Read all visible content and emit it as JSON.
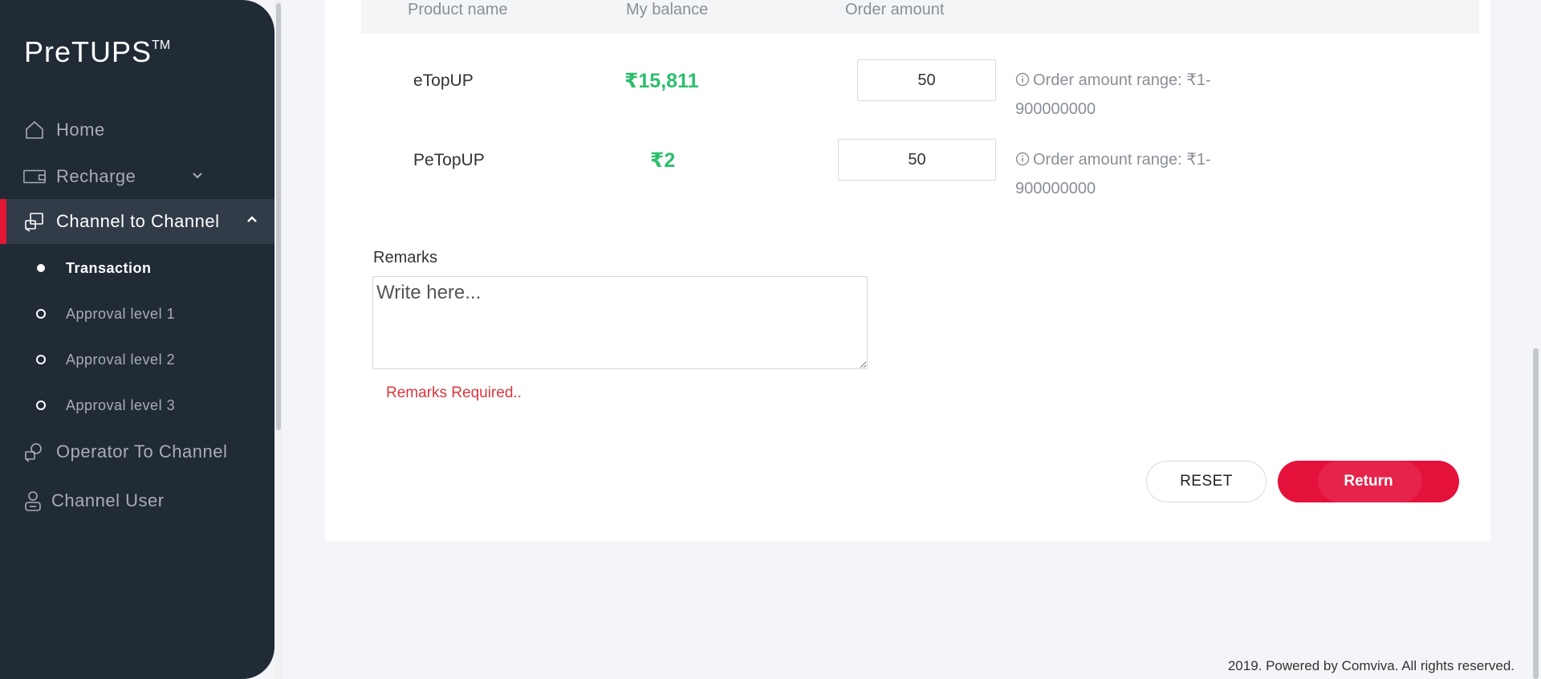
{
  "app": {
    "logo_text": "PreTUPS",
    "logo_tm": "TM"
  },
  "sidebar": {
    "items": [
      {
        "label": "Home",
        "icon": "home-icon"
      },
      {
        "label": "Recharge",
        "icon": "wallet-icon",
        "expand_icon": "chevron-down-icon"
      },
      {
        "label": "Channel to Channel",
        "icon": "channel-transfer-icon",
        "expand_icon": "chevron-up-icon",
        "active": true
      },
      {
        "label": "Operator To Channel",
        "icon": "operator-channel-icon"
      },
      {
        "label": "Channel User",
        "icon": "user-icon"
      }
    ],
    "subitems": [
      {
        "label": "Transaction",
        "active": true
      },
      {
        "label": "Approval level 1"
      },
      {
        "label": "Approval level 2"
      },
      {
        "label": "Approval level 3"
      }
    ]
  },
  "table": {
    "headers": [
      "Product name",
      "My balance",
      "Order amount"
    ],
    "rows": [
      {
        "product": "eTopUP",
        "balance": "₹15,811",
        "amount": "50",
        "range": "Order amount range: ₹1-900000000"
      },
      {
        "product": "PeTopUP",
        "balance": "₹2",
        "amount": "50",
        "range": "Order amount range: ₹1-900000000"
      }
    ]
  },
  "remarks": {
    "label": "Remarks",
    "placeholder": "Write here...",
    "value": "",
    "error": "Remarks Required.."
  },
  "actions": {
    "reset_label": "RESET",
    "return_label": "Return"
  },
  "footer": {
    "text": "2019. Powered by Comviva. All rights reserved."
  },
  "colors": {
    "sidebar_bg": "#212b36",
    "accent_red": "#e4113b",
    "balance_green": "#2dbe6c",
    "error_red": "#d9363e"
  }
}
